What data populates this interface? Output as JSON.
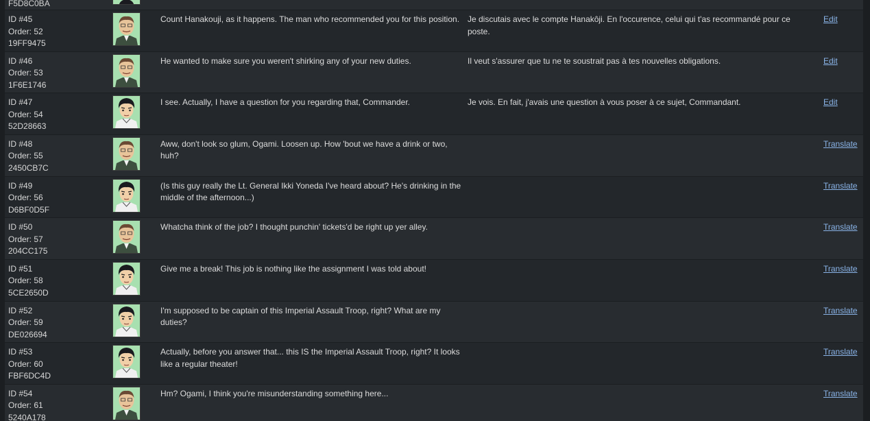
{
  "top_partial": {
    "hash": "F5D8C0BA"
  },
  "rows": [
    {
      "id": "ID #45",
      "order": "Order: 52",
      "hash": "19FF9475",
      "portrait": "general-portrait-icon",
      "en": "Count Hanakouji, as it happens. The man who recommended you for this position.",
      "fr": "Je discutais avec le compte Hanakôji. En l'occurence, celui qui t'as recommandé pour ce poste.",
      "action": "Edit"
    },
    {
      "id": "ID #46",
      "order": "Order: 53",
      "hash": "1F6E1746",
      "portrait": "general-portrait-icon",
      "en": "He wanted to make sure you weren't shirking any of your new duties.",
      "fr": "Il veut s'assurer que tu ne te soustrait pas à tes nouvelles obligations.",
      "action": "Edit"
    },
    {
      "id": "ID #47",
      "order": "Order: 54",
      "hash": "52D28663",
      "portrait": "ogami-portrait-icon",
      "en": "I see. Actually, I have a question for you regarding that, Commander.",
      "fr": "Je vois. En fait, j'avais une question à vous poser à ce sujet, Commandant.",
      "action": "Edit"
    },
    {
      "id": "ID #48",
      "order": "Order: 55",
      "hash": "2450CB7C",
      "portrait": "general-portrait-icon",
      "en": "Aww, don't look so glum, Ogami. Loosen up. How 'bout we have a drink or two, huh?",
      "fr": "",
      "action": "Translate"
    },
    {
      "id": "ID #49",
      "order": "Order: 56",
      "hash": "D6BF0D5F",
      "portrait": "ogami-portrait-icon",
      "en": "(Is this guy really the Lt. General Ikki Yoneda I've heard about? He's drinking in the middle of the afternoon...)",
      "fr": "",
      "action": "Translate"
    },
    {
      "id": "ID #50",
      "order": "Order: 57",
      "hash": "204CC175",
      "portrait": "general-portrait-icon",
      "en": "Whatcha think of the job? I thought punchin' tickets'd be right up yer alley.",
      "fr": "",
      "action": "Translate"
    },
    {
      "id": "ID #51",
      "order": "Order: 58",
      "hash": "5CE2650D",
      "portrait": "ogami-portrait-icon",
      "en": "Give me a break! This job is nothing like the assignment I was told about!",
      "fr": "",
      "action": "Translate"
    },
    {
      "id": "ID #52",
      "order": "Order: 59",
      "hash": "DE026694",
      "portrait": "ogami-portrait-icon",
      "en": "I'm supposed to be captain of this Imperial Assault Troop, right? What are my duties?",
      "fr": "",
      "action": "Translate"
    },
    {
      "id": "ID #53",
      "order": "Order: 60",
      "hash": "FBF6DC4D",
      "portrait": "ogami-portrait-icon",
      "en": "Actually, before you answer that... this IS the Imperial Assault Troop, right? It looks like a regular theater!",
      "fr": "",
      "action": "Translate"
    },
    {
      "id": "ID #54",
      "order": "Order: 61",
      "hash": "5240A178",
      "portrait": "general-portrait-icon",
      "en": "Hm? Ogami, I think you're misunderstanding something here...",
      "fr": "",
      "action": "Translate"
    }
  ]
}
